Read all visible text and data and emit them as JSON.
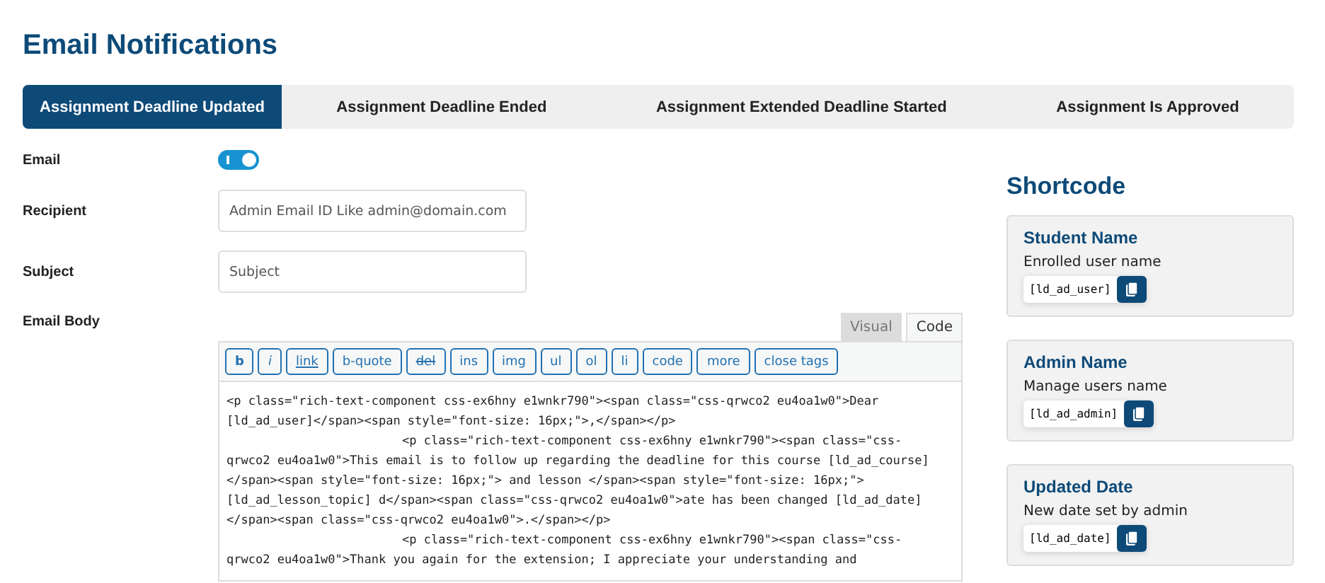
{
  "title": "Email Notifications",
  "tabs": [
    {
      "label": "Assignment Deadline Updated",
      "selected": true
    },
    {
      "label": "Assignment Deadline Ended",
      "selected": false
    },
    {
      "label": "Assignment Extended Deadline Started",
      "selected": false
    },
    {
      "label": "Assignment Is Approved",
      "selected": false
    }
  ],
  "form": {
    "email": {
      "label": "Email",
      "on": true
    },
    "recipient": {
      "label": "Recipient",
      "placeholder": "Admin Email ID Like admin@domain.com"
    },
    "subject": {
      "label": "Subject",
      "placeholder": "Subject"
    },
    "body": {
      "label": "Email Body",
      "modes": [
        {
          "label": "Visual",
          "selected": false
        },
        {
          "label": "Code",
          "selected": true
        }
      ],
      "toolbar": [
        {
          "label": "b",
          "kind": "bold"
        },
        {
          "label": "i",
          "kind": "italic"
        },
        {
          "label": "link",
          "kind": "underline"
        },
        {
          "label": "b-quote",
          "kind": "plain"
        },
        {
          "label": "del",
          "kind": "strike"
        },
        {
          "label": "ins",
          "kind": "plain"
        },
        {
          "label": "img",
          "kind": "plain"
        },
        {
          "label": "ul",
          "kind": "plain"
        },
        {
          "label": "ol",
          "kind": "plain"
        },
        {
          "label": "li",
          "kind": "plain"
        },
        {
          "label": "code",
          "kind": "plain"
        },
        {
          "label": "more",
          "kind": "plain"
        },
        {
          "label": "close tags",
          "kind": "plain"
        }
      ],
      "lines": [
        {
          "text": "<p class=\"rich-text-component css-ex6hny e1wnkr790\"><span class=\"css-qrwco2 eu4oa1w0\">Dear",
          "indent": false
        },
        {
          "text": "[ld_ad_user]</span><span style=\"font-size: 16px;\">,</span></p>",
          "indent": false
        },
        {
          "text": "<p class=\"rich-text-component css-ex6hny e1wnkr790\"><span class=\"css-",
          "indent": true
        },
        {
          "text": "qrwco2 eu4oa1w0\">This email is to follow up regarding the deadline for this course [ld_ad_course]",
          "indent": false
        },
        {
          "text": "</span><span style=\"font-size: 16px;\"> and lesson </span><span style=\"font-size: 16px;\">",
          "indent": false
        },
        {
          "text": "[ld_ad_lesson_topic] d</span><span class=\"css-qrwco2 eu4oa1w0\">ate has been changed [ld_ad_date]",
          "indent": false
        },
        {
          "text": "</span><span class=\"css-qrwco2 eu4oa1w0\">.</span></p>",
          "indent": false
        },
        {
          "text": "<p class=\"rich-text-component css-ex6hny e1wnkr790\"><span class=\"css-",
          "indent": true
        },
        {
          "text": "qrwco2 eu4oa1w0\">Thank you again for the extension; I appreciate your understanding and",
          "indent": false
        }
      ]
    }
  },
  "shortcode": {
    "title": "Shortcode",
    "cards": [
      {
        "name": "Student Name",
        "description": "Enrolled user name",
        "code": "[ld_ad_user]"
      },
      {
        "name": "Admin Name",
        "description": "Manage users name",
        "code": "[ld_ad_admin]"
      },
      {
        "name": "Updated Date",
        "description": "New date set by admin",
        "code": "[ld_ad_date]"
      }
    ]
  }
}
